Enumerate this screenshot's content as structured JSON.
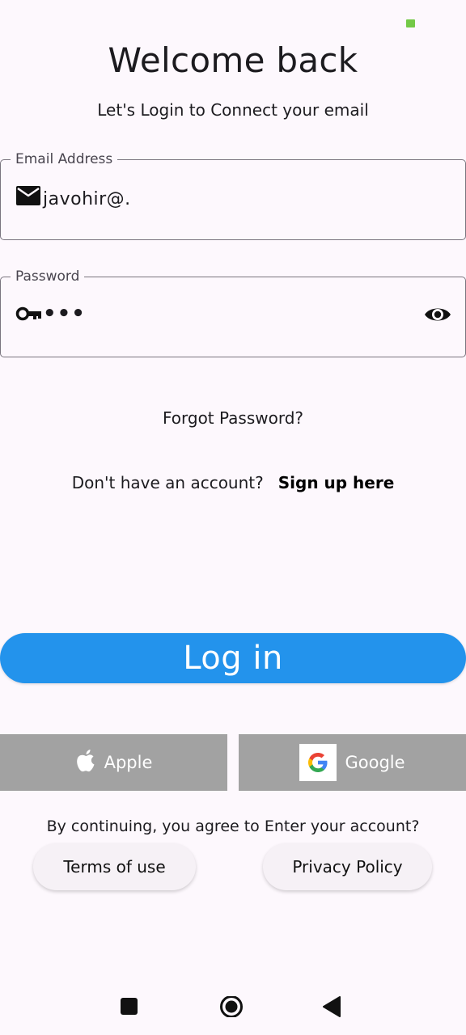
{
  "status_bar": {
    "battery_color": "#74c947"
  },
  "header": {
    "title": "Welcome back",
    "subtitle": "Let's Login to Connect your email"
  },
  "email_field": {
    "label": "Email Address",
    "value": "javohir@.",
    "icon": "mail-icon"
  },
  "password_field": {
    "label": "Password",
    "value": "•••",
    "icon": "key-icon",
    "toggle_icon": "eye-icon"
  },
  "links": {
    "forgot": "Forgot Password?",
    "signup_prompt": "Don't have an account?",
    "signup_link": "Sign up here"
  },
  "login_button": {
    "label": "Log in",
    "color": "#2393ec"
  },
  "social": {
    "apple_label": "Apple",
    "google_label": "Google",
    "button_color": "#a2a2a2"
  },
  "legal": {
    "agreement": "By continuing, you agree to Enter your account?",
    "terms_label": "Terms of use",
    "privacy_label": "Privacy Policy"
  },
  "nav": {
    "recents_icon": "square-icon",
    "home_icon": "circle-icon",
    "back_icon": "triangle-back-icon"
  }
}
